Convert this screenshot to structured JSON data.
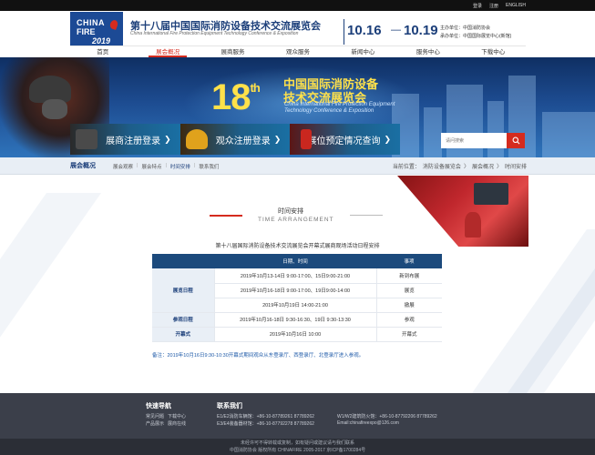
{
  "topbar": {
    "login": "登录",
    "register": "注册",
    "english": "ENGLISH"
  },
  "logo": {
    "line1": "CHINA",
    "line2": "FIRE",
    "year": "2019"
  },
  "header": {
    "title_zh": "第十八届中国国际消防设备技术交流展览会",
    "title_en": "China International Fire Protection Equipment Technology Conference & Exposition",
    "date_start": "10.16",
    "date_sep": "—",
    "date_end": "10.19",
    "organizer_line1": "主办单位：中国消防协会",
    "organizer_line2": "承办单位：中国国际展览中心(新馆)"
  },
  "nav": [
    "首页",
    "展会概况",
    "展商服务",
    "观众服务",
    "新闻中心",
    "服务中心",
    "下载中心"
  ],
  "banner": {
    "number": "18",
    "suffix": "th",
    "zh1": "中国国际消防设备",
    "zh2": "技术交流展览会",
    "en1": "China International Fire Protection Equipment",
    "en2": "Technology Conference & Exposition",
    "btn_exhibitor": "展商注册登录",
    "btn_visitor": "观众注册登录",
    "btn_booth": "展位预定情况查询",
    "search_placeholder": "请问搜索"
  },
  "subnav": {
    "section": "展会概况",
    "items": [
      "展会观察",
      "展会特点",
      "时间安排",
      "联系我们"
    ],
    "sep": "|",
    "location_label": "当前位置：",
    "crumbs": [
      "消防设备展览会",
      "展会概况",
      "时间安排"
    ],
    "crumb_sep": "〉"
  },
  "section": {
    "title_zh": "时间安排",
    "title_en": "TIME ARRANGEMENT",
    "caption": "第十八届国际消防设备技术交流展览会开幕式展商观场活动日程安排"
  },
  "table": {
    "headers": [
      "",
      "日期、时间",
      "事项"
    ],
    "rows": [
      {
        "group": "展览日程",
        "time": "2019年10月13-14日 9:00-17:00、15日9:00-21:00",
        "item": "新到布展"
      },
      {
        "group": "",
        "time": "2019年10月16-18日 9:00-17:00、19日9:00-14:00",
        "item": "展览"
      },
      {
        "group": "",
        "time": "2019年10月19日 14:00-21:00",
        "item": "撤展"
      },
      {
        "group": "参观日程",
        "time": "2019年10月16-18日 9:30-16:30、19日 9:30-13:30",
        "item": "参观"
      },
      {
        "group": "开幕式",
        "time": "2019年10月16日 10:00",
        "item": "开幕式"
      }
    ]
  },
  "note": "备注：2019年10月16日9:30-10:30开幕式期间观众从东登录厅、西登录厅、北登录厅进入参观。",
  "footer": {
    "nav_title": "快速导航",
    "nav_links": [
      "常见问题",
      "下载中心",
      "产品展示",
      "展商在线"
    ],
    "contact_title": "联系我们",
    "contacts": [
      "E1/E2消防车辆馆：+86-10-87789261 87789262",
      "E3/E4装备器材馆：+86-10-87792278 87789262",
      "W1/W2建筑防火馆：+86-10-87792206 87789262",
      "Email:chinafireexpo@126.com"
    ],
    "copy1": "未经许可不得转载或复制，如有疑问或建议请与我们联系",
    "copy2": "中国消防协会 版权所有 CHINAFIRE 2005-2017 京ICP备1700284号"
  }
}
